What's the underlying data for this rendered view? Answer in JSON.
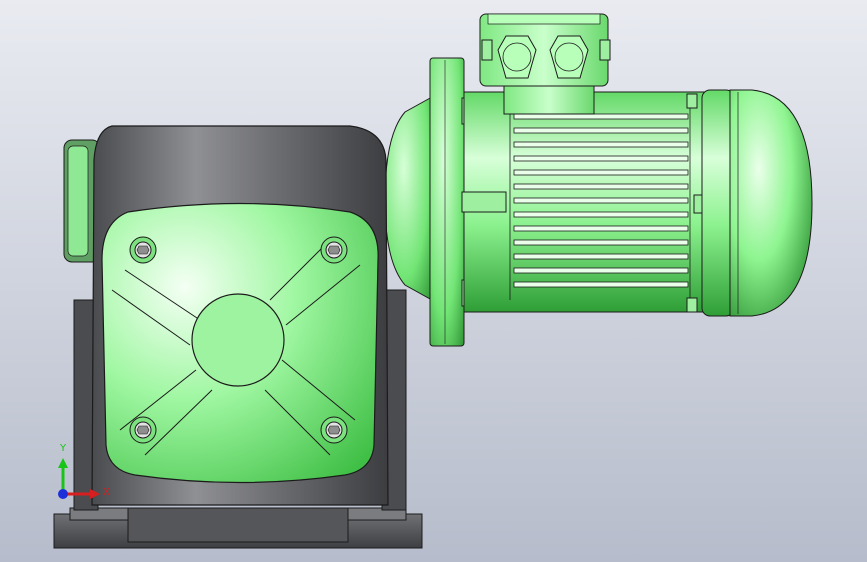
{
  "viewport": {
    "background_top": "#e9ebf1",
    "background_bottom": "#b6bccb"
  },
  "model": {
    "colors": {
      "green_light": "#c9ffcb",
      "green_mid": "#7ff282",
      "green_dark": "#2f9e36",
      "gray_light": "#8d8d90",
      "gray_mid": "#5f6063",
      "gray_dark": "#36373a",
      "edge": "#1b1b1b"
    }
  },
  "triad": {
    "y_label": "Y",
    "x_label": "X",
    "y_color": "#19c419",
    "x_color": "#d81e1e",
    "z_color": "#1d2fd8"
  }
}
